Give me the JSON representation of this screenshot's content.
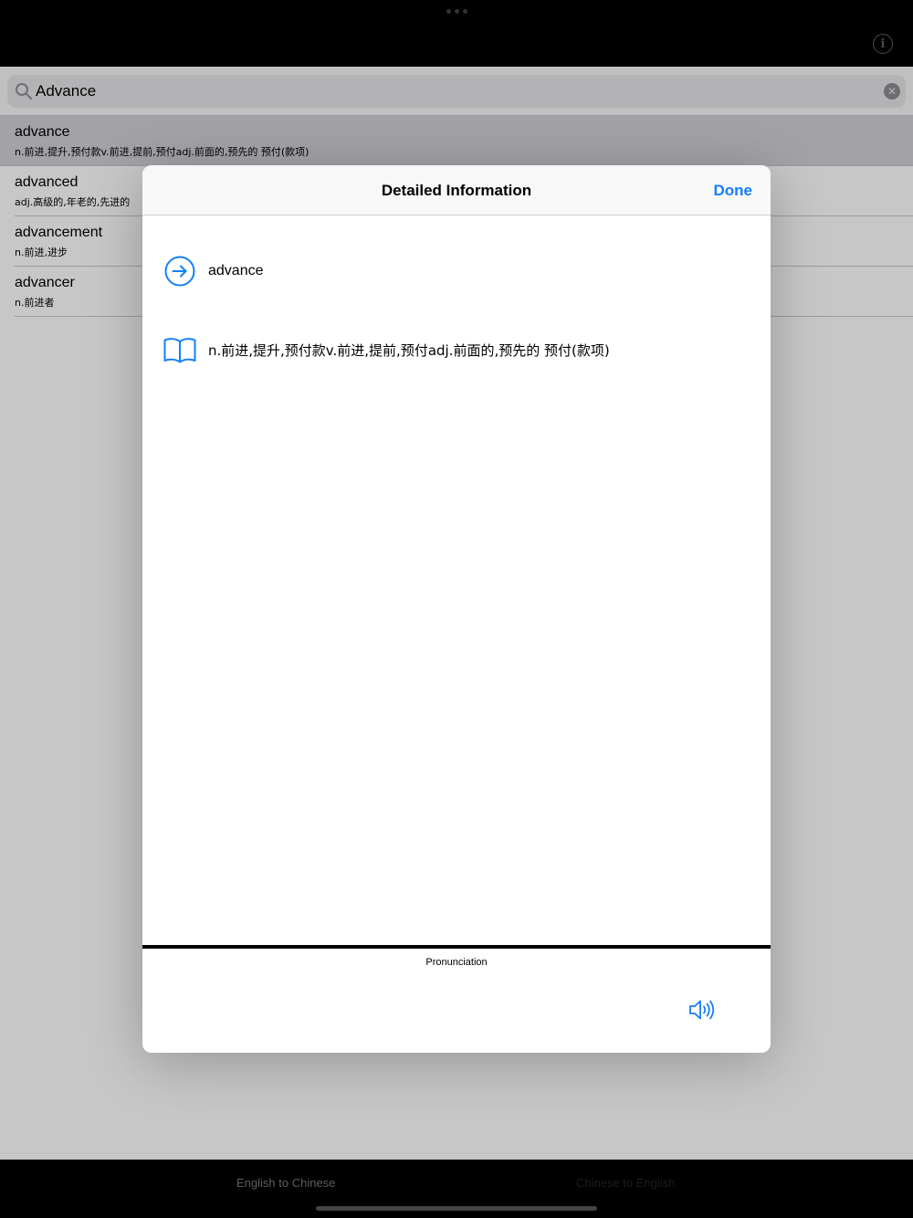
{
  "search": {
    "value": "Advance"
  },
  "results": [
    {
      "word": "advance",
      "definition": "n.前进,提升,预付款v.前进,提前,预付adj.前面的,预先的 预付(款项)"
    },
    {
      "word": "advanced",
      "definition": "adj.高级的,年老的,先进的"
    },
    {
      "word": "advancement",
      "definition": "n.前进,进步"
    },
    {
      "word": "advancer",
      "definition": "n.前进者"
    }
  ],
  "modal": {
    "title": "Detailed Information",
    "done_label": "Done",
    "word": "advance",
    "definition": "n.前进,提升,预付款v.前进,提前,预付adj.前面的,预先的 预付(款项)",
    "pronunciation_label": "Pronunciation"
  },
  "tabs": {
    "english_to_chinese": "English to Chinese",
    "chinese_to_english": "Chinese to English"
  },
  "colors": {
    "accent": "#147efb"
  },
  "icons": {
    "search": "magnifier-icon",
    "clear": "clear-x-icon",
    "info": "info-icon",
    "word": "arrow-right-circle-icon",
    "definition": "book-icon",
    "speaker": "speaker-wave-icon"
  }
}
